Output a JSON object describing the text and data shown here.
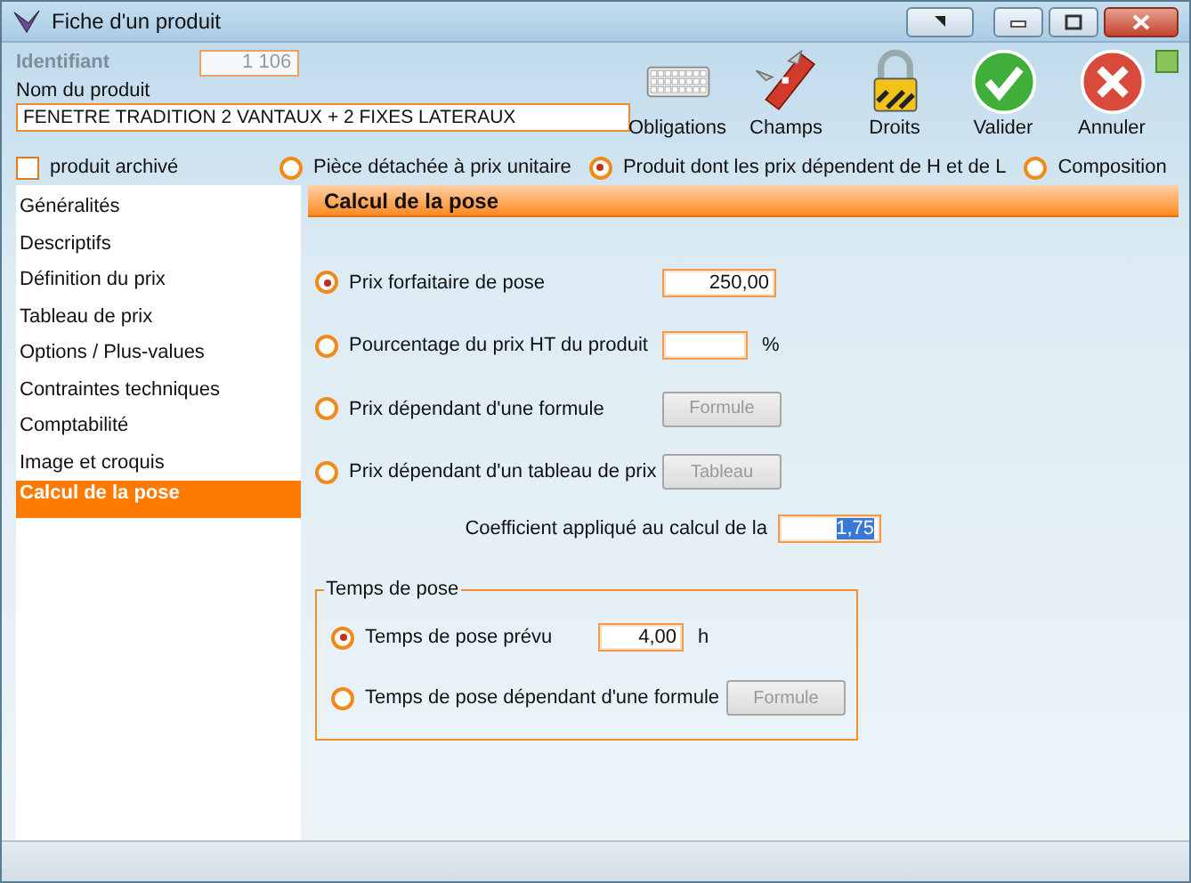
{
  "window": {
    "title": "Fiche d'un produit"
  },
  "identifier": {
    "label": "Identifiant",
    "value": "1 106",
    "disabled": true
  },
  "product_name": {
    "label": "Nom du produit",
    "value": "FENETRE TRADITION 2 VANTAUX + 2 FIXES LATERAUX"
  },
  "toolbar": [
    {
      "label": "Obligations",
      "kind": "keyboard"
    },
    {
      "label": "Champs",
      "kind": "knife"
    },
    {
      "label": "Droits",
      "kind": "lock"
    },
    {
      "label": "Valider",
      "kind": "check"
    },
    {
      "label": "Annuler",
      "kind": "cross"
    }
  ],
  "archived": {
    "label": "produit archivé",
    "checked": false
  },
  "product_types": [
    {
      "label": "Pièce détachée à prix unitaire",
      "selected": false
    },
    {
      "label": "Produit dont les prix dépendent de H et de L",
      "selected": true
    },
    {
      "label": "Composition",
      "selected": false
    }
  ],
  "sidebar": {
    "items": [
      {
        "label": "Généralités",
        "selected": false
      },
      {
        "label": "Descriptifs",
        "selected": false
      },
      {
        "label": "Définition du prix",
        "selected": false
      },
      {
        "label": "Tableau de prix",
        "selected": false
      },
      {
        "label": "Options / Plus-values",
        "selected": false
      },
      {
        "label": "Contraintes techniques",
        "selected": false
      },
      {
        "label": "Comptabilité",
        "selected": false
      },
      {
        "label": "Image et croquis",
        "selected": false
      },
      {
        "label": "Calcul de la pose",
        "selected": true
      }
    ]
  },
  "section_title": "Calcul de la pose",
  "pricing_options": [
    {
      "label": "Prix forfaitaire de pose",
      "selected": true,
      "kind": "field",
      "value": "250,00"
    },
    {
      "label": "Pourcentage du prix HT du produit",
      "selected": false,
      "kind": "field",
      "unit": "%"
    },
    {
      "label": "Prix dépendant d'une formule",
      "selected": false,
      "kind": "button",
      "button": {
        "label": "Formule",
        "disabled": true
      }
    },
    {
      "label": "Prix dépendant d'un tableau de prix",
      "selected": false,
      "kind": "button",
      "button": {
        "label": "Tableau",
        "disabled": true
      }
    }
  ],
  "coefficient": {
    "label": "Coefficient appliqué au calcul de la",
    "value": "1,75"
  },
  "laying_time": {
    "title": "Temps de pose",
    "options": [
      {
        "label": "Temps de pose prévu",
        "selected": true,
        "kind": "field",
        "value": "4,00",
        "unit": "h"
      },
      {
        "label": "Temps de pose dépendant d'une formule",
        "selected": false,
        "kind": "button",
        "button": {
          "label": "Formule",
          "disabled": true
        }
      }
    ]
  }
}
